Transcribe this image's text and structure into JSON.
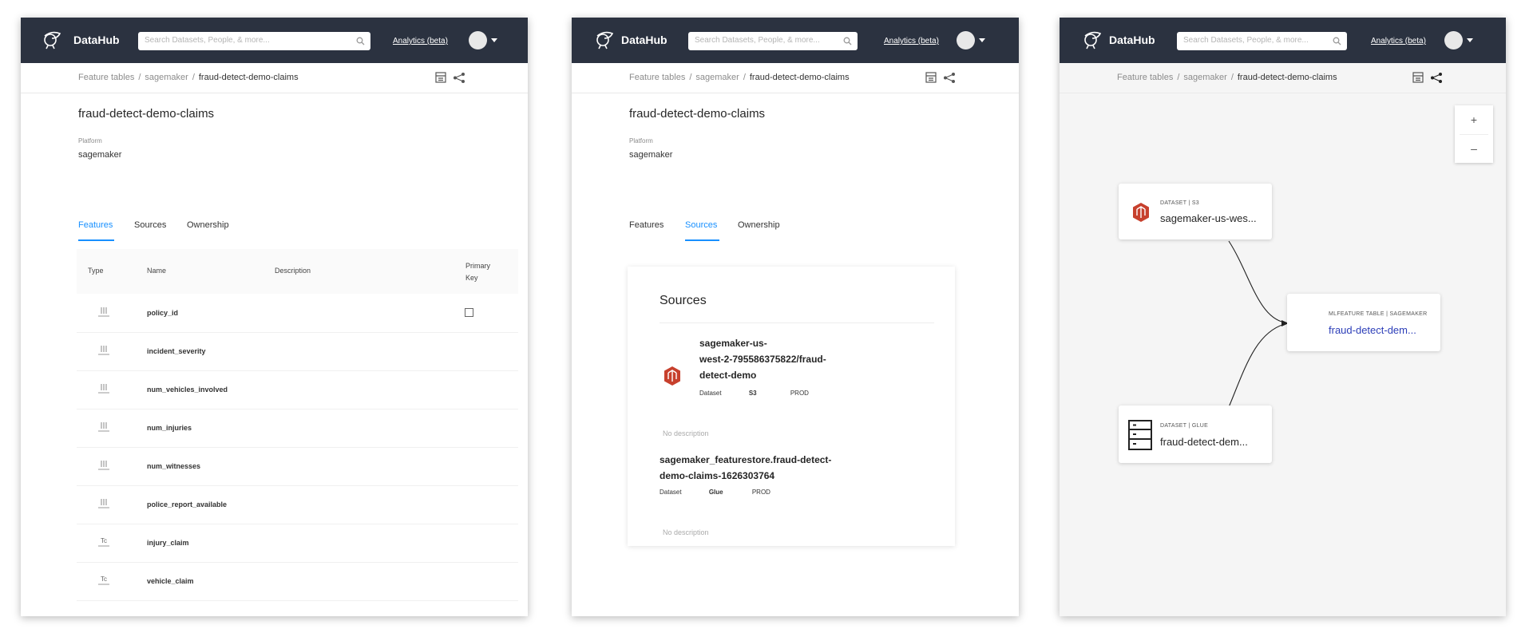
{
  "nav": {
    "brand": "DataHub",
    "search_placeholder": "Search Datasets, People, & more...",
    "analytics_link": "Analytics (beta)"
  },
  "breadcrumb": {
    "items": [
      "Feature tables",
      "sagemaker",
      "fraud-detect-demo-claims"
    ]
  },
  "entity": {
    "title": "fraud-detect-demo-claims",
    "platform_label": "Platform",
    "platform_value": "sagemaker"
  },
  "tabs": [
    "Features",
    "Sources",
    "Ownership"
  ],
  "features_table": {
    "headers": [
      "Type",
      "Name",
      "Description",
      "Primary Key"
    ],
    "rows": [
      {
        "name": "policy_id",
        "type_icon": "numeric-type-icon",
        "primary_key": true
      },
      {
        "name": "incident_severity",
        "type_icon": "numeric-type-icon",
        "primary_key": false
      },
      {
        "name": "num_vehicles_involved",
        "type_icon": "numeric-type-icon",
        "primary_key": false
      },
      {
        "name": "num_injuries",
        "type_icon": "numeric-type-icon",
        "primary_key": false
      },
      {
        "name": "num_witnesses",
        "type_icon": "numeric-type-icon",
        "primary_key": false
      },
      {
        "name": "police_report_available",
        "type_icon": "numeric-type-icon",
        "primary_key": false
      },
      {
        "name": "injury_claim",
        "type_icon": "text-type-icon",
        "primary_key": false
      },
      {
        "name": "vehicle_claim",
        "type_icon": "text-type-icon",
        "primary_key": false
      }
    ]
  },
  "sources": {
    "title": "Sources",
    "items": [
      {
        "name_lines": [
          "sagemaker-us-",
          "west-2-795586375822/fraud-",
          "detect-demo"
        ],
        "entity_type": "Dataset",
        "platform": "S3",
        "env": "PROD",
        "description": "No description"
      },
      {
        "name_lines": [
          "sagemaker_featurestore.fraud-detect-",
          "demo-claims-1626303764"
        ],
        "entity_type": "Dataset",
        "platform": "Glue",
        "env": "PROD",
        "description": "No description"
      }
    ]
  },
  "lineage": {
    "zoom_in": "+",
    "zoom_out": "–",
    "nodes": [
      {
        "type_label": "DATASET | S3",
        "name": "sagemaker-us-wes..."
      },
      {
        "type_label": "MLFEATURE TABLE | SAGEMAKER",
        "name": "fraud-detect-dem..."
      },
      {
        "type_label": "DATASET | GLUE",
        "name": "fraud-detect-dem..."
      }
    ]
  },
  "colors": {
    "nav_bg": "#2b3240",
    "accent": "#1890ff",
    "sagemaker_red": "#c7402d",
    "link": "#2c3eb8"
  }
}
